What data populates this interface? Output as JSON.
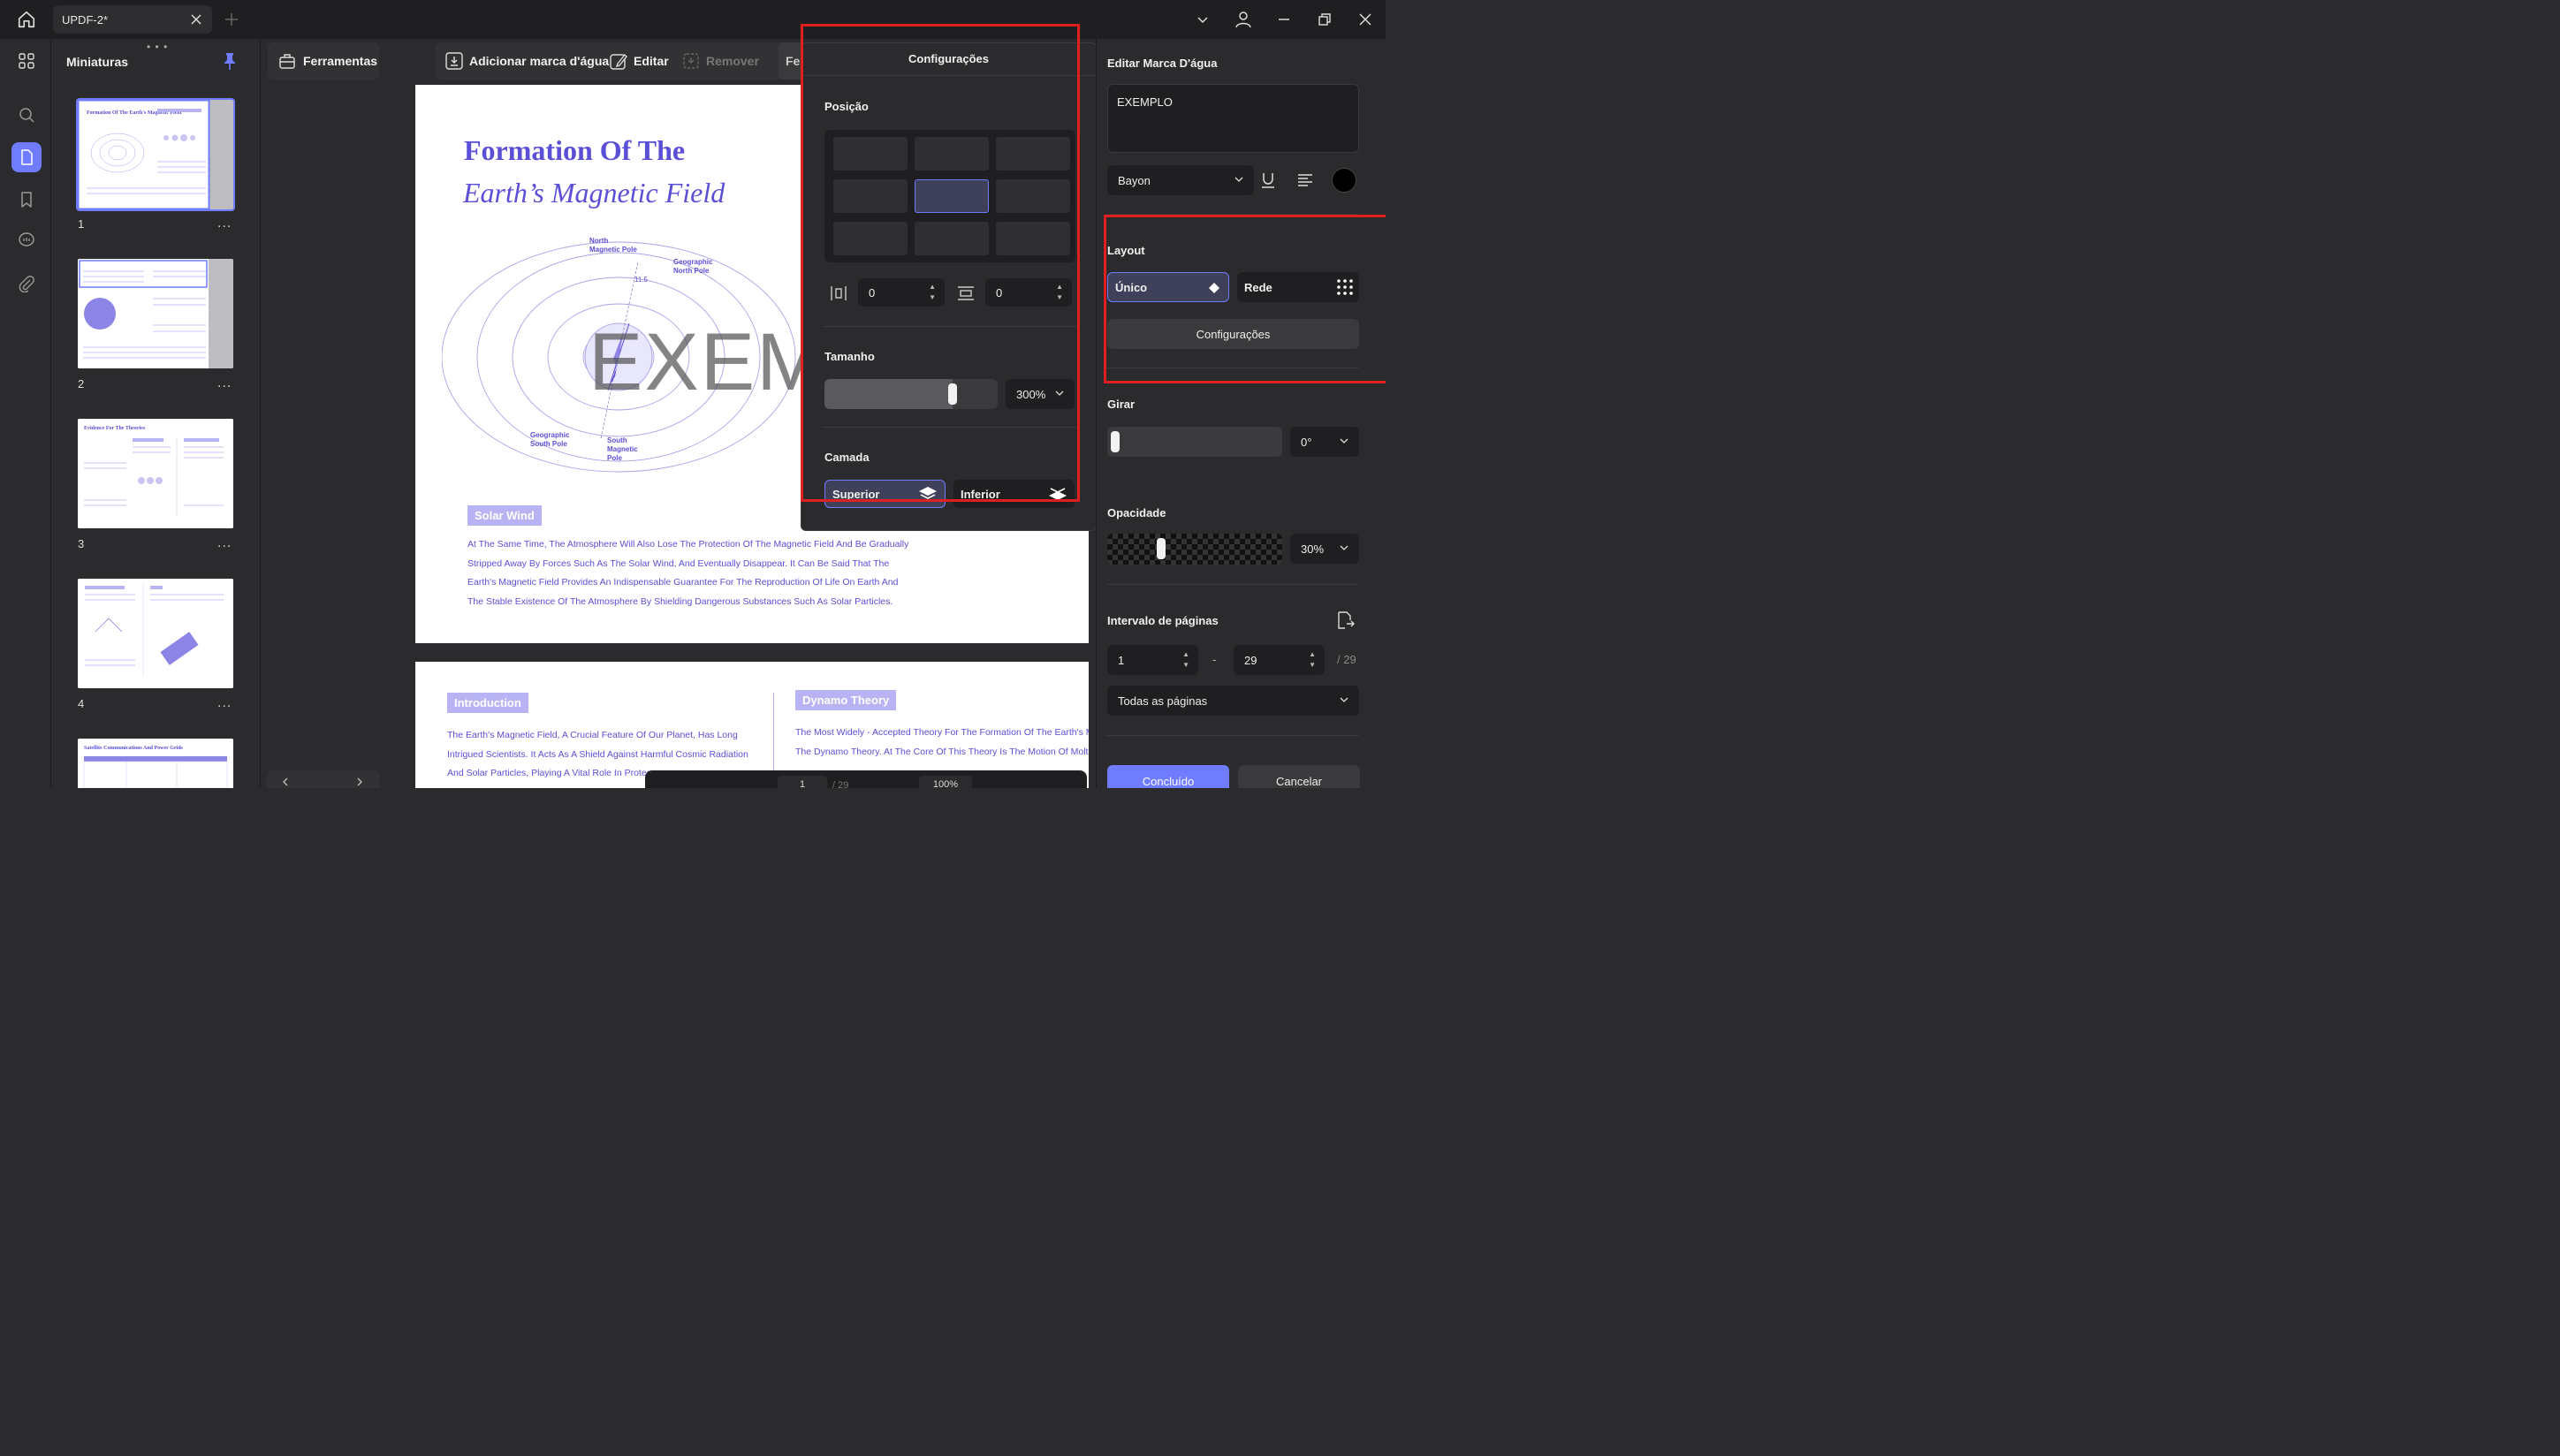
{
  "titlebar": {
    "tab_title": "UPDF-2*",
    "home_icon": "home-icon",
    "window_controls": [
      "chevron-down-icon",
      "user-icon",
      "minimize-icon",
      "restore-icon",
      "close-icon"
    ]
  },
  "rail": {
    "items": [
      "grid-icon",
      "search-icon",
      "document-icon",
      "bookmark-icon",
      "comment-icon",
      "attachment-icon"
    ],
    "active": "document-icon",
    "accent": "#6f7cff"
  },
  "thumbnails": {
    "title": "Miniaturas",
    "pages": [
      {
        "num": "1",
        "title": "Formation Of The Earth's Magnetic Field"
      },
      {
        "num": "2",
        "title": ""
      },
      {
        "num": "3",
        "title": "Evidence For The Theories"
      },
      {
        "num": "4",
        "title": ""
      },
      {
        "num": "",
        "title": "Satellite Communications And Power Grids"
      }
    ],
    "more": "..."
  },
  "toolbar": {
    "tools_label": "Ferramentas",
    "add_watermark": "Adicionar marca d'água",
    "edit": "Editar",
    "remove": "Remover",
    "truncated": "Fe"
  },
  "document": {
    "page1": {
      "title_line1": "Formation Of The",
      "title_line2": "Earth’s Magnetic Field",
      "watermark_text": "EXEM",
      "diagram_labels": {
        "north_magnetic": "North\nMagnetic Pole",
        "geographic_north": "Geographic\nNorth Pole",
        "angle": "11.5",
        "geographic_south": "Geographic\nSouth Pole",
        "south_magnetic": "South\nMagnetic\nPole"
      },
      "solar_wind_label": "Solar Wind",
      "paragraph": [
        "At The Same Time, The Atmosphere Will Also Lose The Protection Of The Magnetic Field And Be Gradually",
        "Stripped Away By Forces Such As The Solar Wind, And Eventually Disappear. It Can Be Said That The",
        "Earth's Magnetic Field Provides An Indispensable Guarantee For The Reproduction Of Life On Earth And",
        "The Stable Existence Of The Atmosphere By Shielding Dangerous Substances Such As Solar Particles."
      ]
    },
    "page2": {
      "intro_label": "Introduction",
      "intro_lines": [
        "The Earth's Magnetic Field, A Crucial Feature Of Our Planet, Has Long",
        "Intrigued Scientists. It Acts As A Shield Against Harmful Cosmic Radiation",
        "And Solar Particles, Playing A Vital Role In Protec"
      ],
      "dynamo_label": "Dynamo Theory",
      "dynamo_lines": [
        "The Most Widely - Accepted Theory For The Formation Of The Earth's Ma",
        "The Dynamo Theory. At The Core Of This Theory Is The Motion Of Molten"
      ]
    },
    "bottom_bar": {
      "page_input": "1",
      "page_total": "/ 29",
      "zoom": "100%"
    }
  },
  "settings_popup": {
    "title": "Configurações",
    "position_label": "Posição",
    "selected_cell": 4,
    "offset_x": "0",
    "offset_y": "0",
    "size_label": "Tamanho",
    "size_value": "300%",
    "size_fraction": 0.75,
    "layer_label": "Camada",
    "layer_top": "Superior",
    "layer_bottom": "Inferior",
    "layer_selected": "Superior"
  },
  "right_panel": {
    "title": "Editar Marca D'água",
    "watermark_text": "EXEMPLO",
    "font": "Bayon",
    "text_color": "#000000",
    "layout_label": "Layout",
    "layout_single": "Único",
    "layout_grid": "Rede",
    "layout_selected": "Único",
    "config_button": "Configurações",
    "rotate_label": "Girar",
    "rotate_value": "0°",
    "rotate_fraction": 0.0,
    "opacity_label": "Opacidade",
    "opacity_value": "30%",
    "opacity_fraction": 0.3,
    "page_range_label": "Intervalo de páginas",
    "range_from": "1",
    "range_dash": "-",
    "range_to": "29",
    "range_total": "/ 29",
    "range_mode": "Todas as páginas",
    "done_button": "Concluído",
    "cancel_button": "Cancelar"
  },
  "colors": {
    "accent": "#6f7cff",
    "highlight_red": "#e02020",
    "document_text": "#5b4fd6"
  }
}
